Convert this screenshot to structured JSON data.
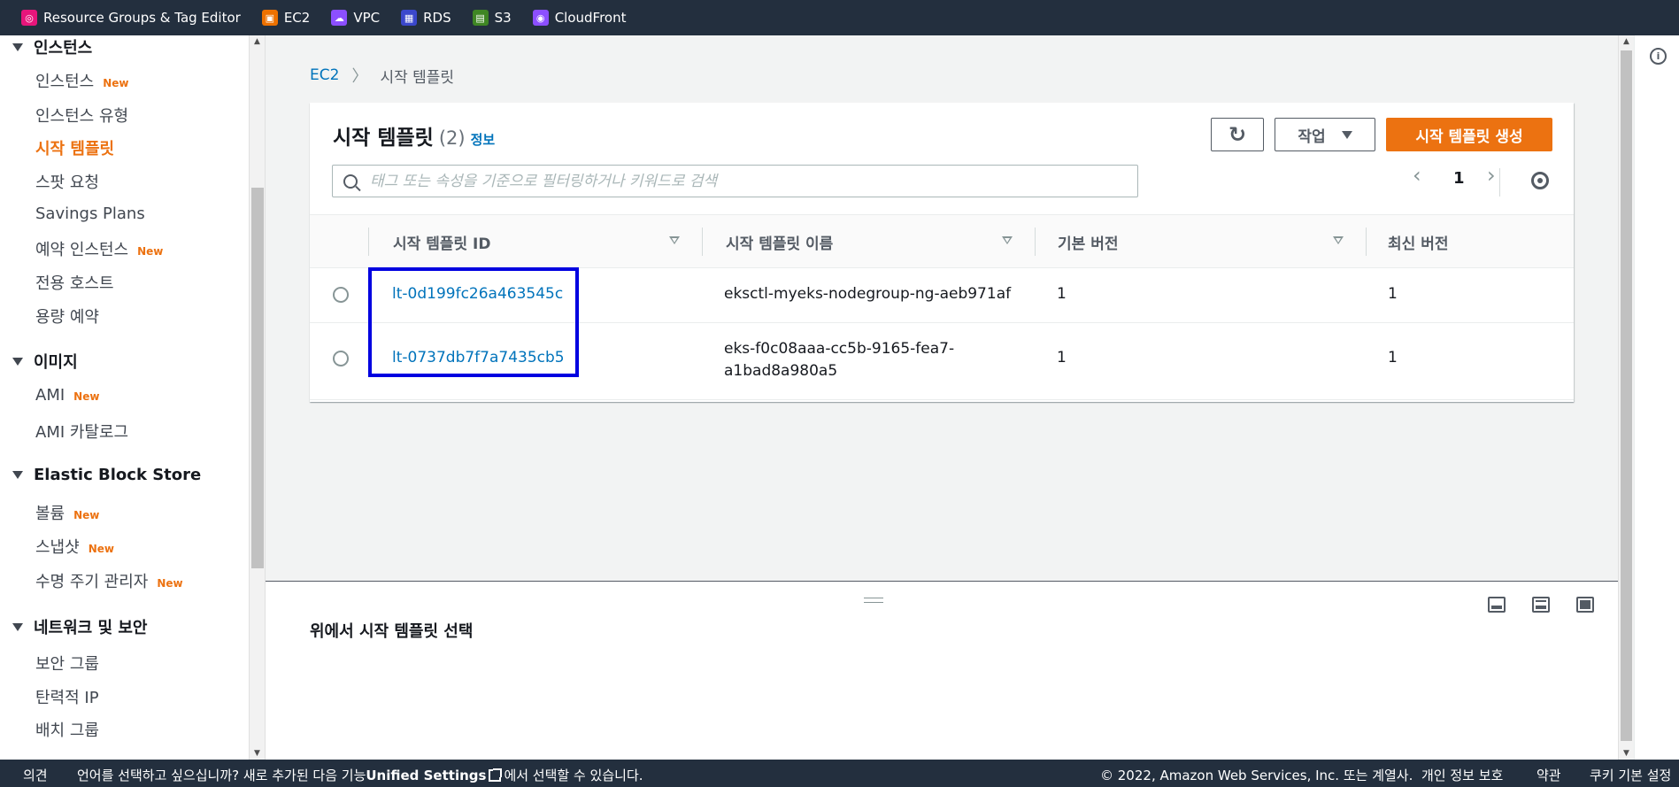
{
  "topbar": {
    "services": [
      {
        "label": "Resource Groups & Tag Editor",
        "icon": "resource-groups-icon",
        "color": "#e7157b"
      },
      {
        "label": "EC2",
        "icon": "ec2-icon",
        "color": "#ed7100"
      },
      {
        "label": "VPC",
        "icon": "vpc-icon",
        "color": "#8c4fff"
      },
      {
        "label": "RDS",
        "icon": "rds-icon",
        "color": "#3b48cc"
      },
      {
        "label": "S3",
        "icon": "s3-icon",
        "color": "#3f8624"
      },
      {
        "label": "CloudFront",
        "icon": "cloudfront-icon",
        "color": "#8c4fff"
      }
    ]
  },
  "sidebar": {
    "sections": [
      {
        "title": "인스턴스",
        "items": [
          {
            "label": "인스턴스",
            "badge": "New"
          },
          {
            "label": "인스턴스 유형"
          },
          {
            "label": "시작 템플릿",
            "active": true
          },
          {
            "label": "스팟 요청"
          },
          {
            "label": "Savings Plans"
          },
          {
            "label": "예약 인스턴스",
            "badge": "New"
          },
          {
            "label": "전용 호스트"
          },
          {
            "label": "용량 예약"
          }
        ]
      },
      {
        "title": "이미지",
        "items": [
          {
            "label": "AMI",
            "badge": "New"
          },
          {
            "label": "AMI 카탈로그"
          }
        ]
      },
      {
        "title": "Elastic Block Store",
        "items": [
          {
            "label": "볼륨",
            "badge": "New"
          },
          {
            "label": "스냅샷",
            "badge": "New"
          },
          {
            "label": "수명 주기 관리자",
            "badge": "New"
          }
        ]
      },
      {
        "title": "네트워크 및 보안",
        "items": [
          {
            "label": "보안 그룹"
          },
          {
            "label": "탄력적 IP"
          },
          {
            "label": "배치 그룹"
          }
        ]
      }
    ]
  },
  "breadcrumb": {
    "root": "EC2",
    "current": "시작 템플릿"
  },
  "panel": {
    "title": "시작 템플릿",
    "count": "(2)",
    "info": "정보",
    "actions_label": "작업",
    "create_label": "시작 템플릿 생성",
    "search_placeholder": "태그 또는 속성을 기준으로 필터링하거나 키워드로 검색",
    "page": "1"
  },
  "table": {
    "columns": [
      "시작 템플릿 ID",
      "시작 템플릿 이름",
      "기본 버전",
      "최신 버전"
    ],
    "rows": [
      {
        "id": "lt-0d199fc26a463545c",
        "name": "eksctl-myeks-nodegroup-ng-aeb971af",
        "name2": "",
        "default": "1",
        "latest": "1"
      },
      {
        "id": "lt-0737db7f7a7435cb5",
        "name": "eks-f0c08aaa-cc5b-9165-fea7-",
        "name2": "a1bad8a980a5",
        "default": "1",
        "latest": "1"
      }
    ]
  },
  "split": {
    "message": "위에서 시작 템플릿 선택"
  },
  "footer": {
    "feedback": "의견",
    "lang_prefix": "언어를 선택하고 싶으십니까? 새로 추가된 다음 기능",
    "unified": "Unified Settings",
    "lang_suffix": "에서 선택할 수 있습니다.",
    "copyright": "© 2022, Amazon Web Services, Inc. 또는 계열사.",
    "privacy": "개인 정보 보호",
    "terms": "약관",
    "cookies": "쿠키 기본 설정"
  },
  "colors": {
    "accent": "#ec7211",
    "link": "#0073bb",
    "nav_bg": "#232f3e",
    "highlight": "#0000e0"
  }
}
